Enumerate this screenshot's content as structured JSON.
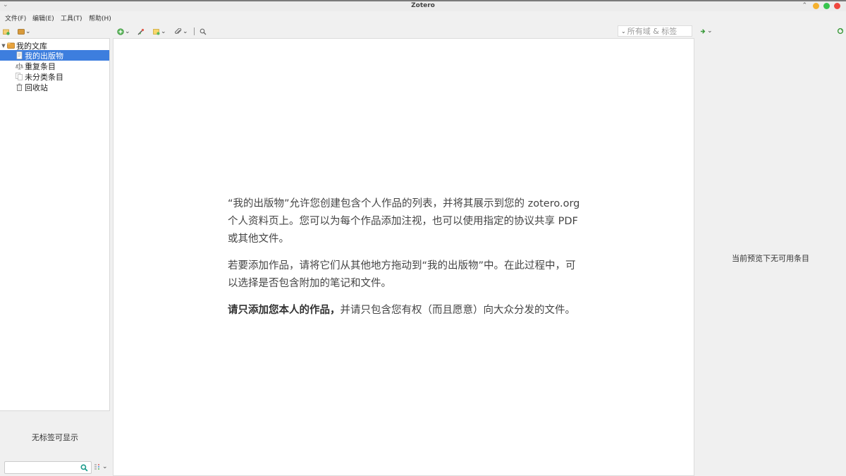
{
  "window": {
    "title": "Zotero"
  },
  "menu": [
    "文件(F)",
    "编辑(E)",
    "工具(T)",
    "帮助(H)"
  ],
  "search": {
    "placeholder": "所有域 & 标签"
  },
  "collections": {
    "library": "我的文库",
    "items": [
      "我的出版物",
      "重复条目",
      "未分类条目",
      "回收站"
    ]
  },
  "tags": {
    "none_label": "无标签可显示",
    "filter_value": ""
  },
  "intro": {
    "p1": "“我的出版物”允许您创建包含个人作品的列表，并将其展示到您的 zotero.org 个人资料页上。您可以为每个作品添加注视，也可以使用指定的协议共享 PDF 或其他文件。",
    "p2": "若要添加作品，请将它们从其他地方拖动到“我的出版物”中。在此过程中，可以选择是否包含附加的笔记和文件。",
    "p3_bold": "请只添加您本人的作品，",
    "p3_rest": "并请只包含您有权（而且愿意）向大众分发的文件。"
  },
  "item_pane": {
    "message": "当前预览下无可用条目"
  },
  "colors": {
    "selection": "#3d7ede",
    "folder": "#e8a33d"
  },
  "icons": [
    "new-collection-icon",
    "library-actions-icon",
    "new-item-icon",
    "magic-wand-icon",
    "new-note-icon",
    "attachment-icon",
    "search-icon",
    "locate-icon",
    "folder-icon",
    "publication-icon",
    "duplicate-icon",
    "unfiled-icon",
    "trash-icon",
    "tag-selector-icon"
  ]
}
